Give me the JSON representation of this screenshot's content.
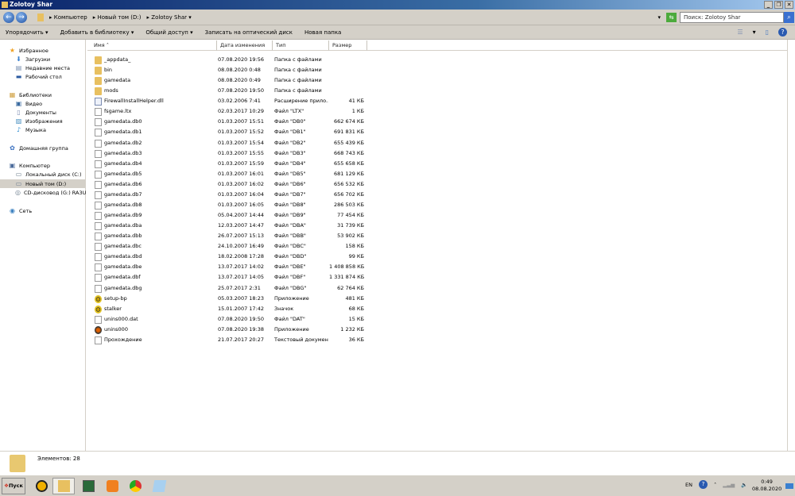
{
  "window": {
    "title": "Zolotoy Shar",
    "min": "_",
    "max": "❐",
    "close": "✕"
  },
  "address": {
    "crumbs": [
      "Компьютер",
      "Новый том (D:)",
      "Zolotoy Shar"
    ],
    "search_placeholder": "Поиск: Zolotoy Shar"
  },
  "toolbar": {
    "organize": "Упорядочить",
    "add_library": "Добавить в библиотеку",
    "share": "Общий доступ",
    "burn": "Записать на оптический диск",
    "new_folder": "Новая папка"
  },
  "sidebar": {
    "items": [
      {
        "label": "Избранное",
        "icon": "star-icon"
      },
      {
        "label": "Загрузки",
        "icon": "downloads-icon"
      },
      {
        "label": "Недавние места",
        "icon": "recent-places-icon"
      },
      {
        "label": "Рабочий стол",
        "icon": "desktop-icon"
      },
      {
        "label": "Библиотеки",
        "icon": "libraries-icon"
      },
      {
        "label": "Видео",
        "icon": "video-icon"
      },
      {
        "label": "Документы",
        "icon": "documents-icon"
      },
      {
        "label": "Изображения",
        "icon": "pictures-icon"
      },
      {
        "label": "Музыка",
        "icon": "music-icon"
      },
      {
        "label": "Домашняя группа",
        "icon": "homegroup-icon"
      },
      {
        "label": "Компьютер",
        "icon": "computer-icon"
      },
      {
        "label": "Локальный диск (C:)",
        "icon": "drive-icon"
      },
      {
        "label": "Новый том (D:)",
        "icon": "drive-icon",
        "selected": true
      },
      {
        "label": "CD-дисковод (G:) RA3U_D",
        "icon": "cd-drive-icon"
      },
      {
        "label": "Сеть",
        "icon": "network-icon"
      }
    ]
  },
  "columns": {
    "name": "Имя",
    "date": "Дата изменения",
    "type": "Тип",
    "size": "Размер"
  },
  "files": [
    {
      "name": "_appdata_",
      "date": "07.08.2020 19:56",
      "type": "Папка с файлами",
      "size": "",
      "icon": "folder"
    },
    {
      "name": "bin",
      "date": "08.08.2020 0:48",
      "type": "Папка с файлами",
      "size": "",
      "icon": "folder"
    },
    {
      "name": "gamedata",
      "date": "08.08.2020 0:49",
      "type": "Папка с файлами",
      "size": "",
      "icon": "folder"
    },
    {
      "name": "mods",
      "date": "07.08.2020 19:50",
      "type": "Папка с файлами",
      "size": "",
      "icon": "folder"
    },
    {
      "name": "FirewallInstallHelper.dll",
      "date": "03.02.2006 7:41",
      "type": "Расширение прило...",
      "size": "41 КБ",
      "icon": "dll"
    },
    {
      "name": "fsgame.ltx",
      "date": "02.03.2017 10:29",
      "type": "Файл \"LTX\"",
      "size": "1 КБ",
      "icon": "file"
    },
    {
      "name": "gamedata.db0",
      "date": "01.03.2007 15:51",
      "type": "Файл \"DB0\"",
      "size": "662 674 КБ",
      "icon": "file"
    },
    {
      "name": "gamedata.db1",
      "date": "01.03.2007 15:52",
      "type": "Файл \"DB1\"",
      "size": "691 831 КБ",
      "icon": "file"
    },
    {
      "name": "gamedata.db2",
      "date": "01.03.2007 15:54",
      "type": "Файл \"DB2\"",
      "size": "655 439 КБ",
      "icon": "file"
    },
    {
      "name": "gamedata.db3",
      "date": "01.03.2007 15:55",
      "type": "Файл \"DB3\"",
      "size": "668 743 КБ",
      "icon": "file"
    },
    {
      "name": "gamedata.db4",
      "date": "01.03.2007 15:59",
      "type": "Файл \"DB4\"",
      "size": "655 658 КБ",
      "icon": "file"
    },
    {
      "name": "gamedata.db5",
      "date": "01.03.2007 16:01",
      "type": "Файл \"DB5\"",
      "size": "681 129 КБ",
      "icon": "file"
    },
    {
      "name": "gamedata.db6",
      "date": "01.03.2007 16:02",
      "type": "Файл \"DB6\"",
      "size": "656 532 КБ",
      "icon": "file"
    },
    {
      "name": "gamedata.db7",
      "date": "01.03.2007 16:04",
      "type": "Файл \"DB7\"",
      "size": "656 702 КБ",
      "icon": "file"
    },
    {
      "name": "gamedata.db8",
      "date": "01.03.2007 16:05",
      "type": "Файл \"DB8\"",
      "size": "286 503 КБ",
      "icon": "file"
    },
    {
      "name": "gamedata.db9",
      "date": "05.04.2007 14:44",
      "type": "Файл \"DB9\"",
      "size": "77 454 КБ",
      "icon": "file"
    },
    {
      "name": "gamedata.dba",
      "date": "12.03.2007 14:47",
      "type": "Файл \"DBA\"",
      "size": "31 739 КБ",
      "icon": "file"
    },
    {
      "name": "gamedata.dbb",
      "date": "26.07.2007 15:13",
      "type": "Файл \"DBB\"",
      "size": "53 902 КБ",
      "icon": "file"
    },
    {
      "name": "gamedata.dbc",
      "date": "24.10.2007 16:49",
      "type": "Файл \"DBC\"",
      "size": "158 КБ",
      "icon": "file"
    },
    {
      "name": "gamedata.dbd",
      "date": "18.02.2008 17:28",
      "type": "Файл \"DBD\"",
      "size": "99 КБ",
      "icon": "file"
    },
    {
      "name": "gamedata.dbe",
      "date": "13.07.2017 14:02",
      "type": "Файл \"DBE\"",
      "size": "1 408 858 КБ",
      "icon": "file"
    },
    {
      "name": "gamedata.dbf",
      "date": "13.07.2017 14:05",
      "type": "Файл \"DBF\"",
      "size": "1 331 874 КБ",
      "icon": "file"
    },
    {
      "name": "gamedata.dbg",
      "date": "25.07.2017 2:31",
      "type": "Файл \"DBG\"",
      "size": "62 764 КБ",
      "icon": "file"
    },
    {
      "name": "setup-bp",
      "date": "05.03.2007 18:23",
      "type": "Приложение",
      "size": "481 КБ",
      "icon": "app"
    },
    {
      "name": "stalker",
      "date": "15.01.2007 17:42",
      "type": "Значок",
      "size": "68 КБ",
      "icon": "app"
    },
    {
      "name": "unins000.dat",
      "date": "07.08.2020 19:50",
      "type": "Файл \"DAT\"",
      "size": "15 КБ",
      "icon": "file"
    },
    {
      "name": "unins000",
      "date": "07.08.2020 19:38",
      "type": "Приложение",
      "size": "1 232 КБ",
      "icon": "app2"
    },
    {
      "name": "Прохождение",
      "date": "21.07.2017 20:27",
      "type": "Текстовый документ",
      "size": "36 КБ",
      "icon": "file"
    }
  ],
  "status": {
    "count": "Элементов: 28"
  },
  "taskbar": {
    "start": "Пуск",
    "lang": "EN",
    "time": "0:49",
    "date": "08.08.2020"
  }
}
